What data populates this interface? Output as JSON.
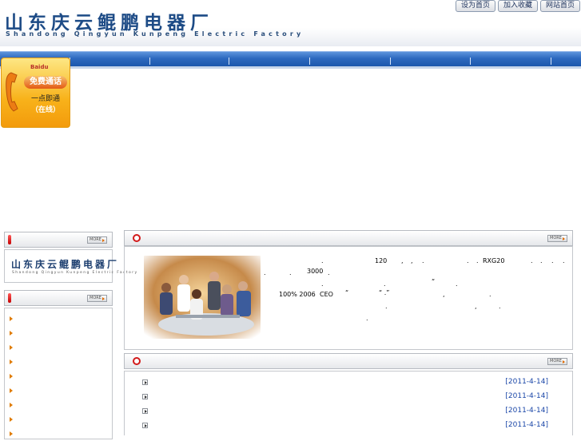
{
  "header": {
    "logo_cn": "山东庆云鲲鹏电器厂",
    "logo_en": "Shandong Qingyun Kunpeng Electric Factory",
    "links": [
      "设为首页",
      "加入收藏",
      "网站首页"
    ]
  },
  "call_widget": {
    "brand": "Baidu",
    "button": "免费通话",
    "subtitle": "一点即通",
    "status": "（在线）"
  },
  "left": {
    "more1": "MORE",
    "mini_logo_cn": "山东庆云鲲鹏电器厂",
    "mini_logo_en": "Shandong Qingyun Kunpeng Electric Factory",
    "more2": "MORE"
  },
  "intro": {
    "more": "MORE",
    "fragments": [
      ".",
      "120",
      ",",
      ",",
      ".",
      ".",
      ".",
      "RXG20",
      ".",
      ".",
      ".",
      ".",
      ".",
      ".",
      "3000",
      ".",
      ".",
      ".",
      "“",
      ".",
      "100% 2006",
      "CEO",
      "“",
      "“ .”",
      ",",
      ".",
      ".",
      ",",
      ".",
      "."
    ]
  },
  "news": {
    "more": "MORE",
    "dates": [
      "[2011-4-14]",
      "[2011-4-14]",
      "[2011-4-14]",
      "[2011-4-14]"
    ]
  },
  "colors": {
    "nav_blue": "#2d69bf",
    "logo_blue": "#1d4b86",
    "date_blue": "#1b47a8",
    "accent_red": "#d21a1a",
    "call_orange": "#f8b21a"
  }
}
